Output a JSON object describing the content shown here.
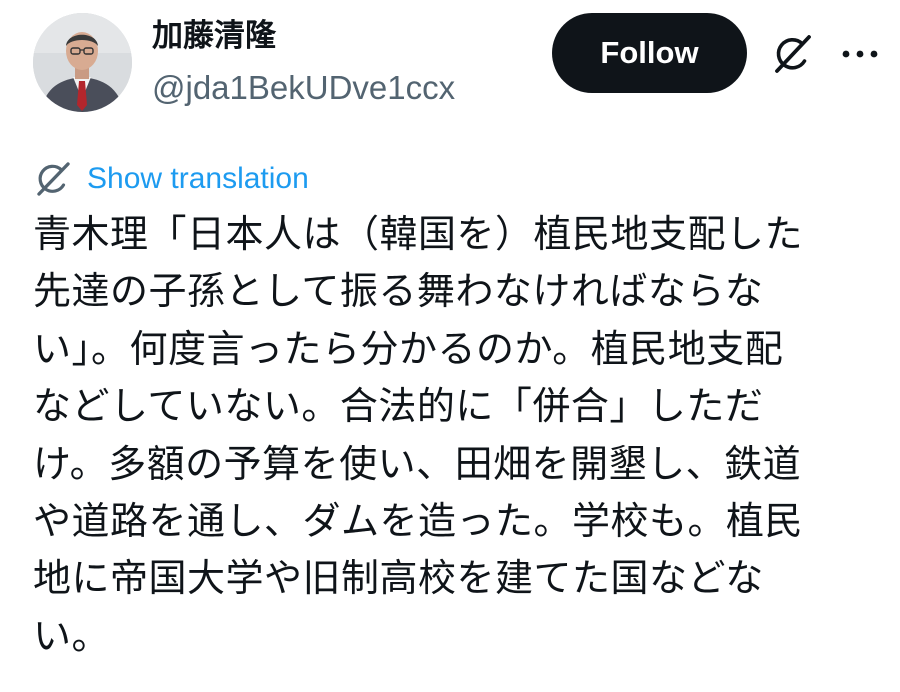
{
  "author": {
    "display_name": "加藤清隆",
    "handle": "@jda1BekUDve1ccx"
  },
  "actions": {
    "follow_label": "Follow"
  },
  "translation": {
    "label": "Show translation"
  },
  "tweet": {
    "lines": [
      "青木理「日本人は（韓国を）植民地支配した",
      "先達の子孫として振る舞わなければならな",
      "い」。何度言ったら分かるのか。植民地支配",
      "などしていない。合法的に「併合」しただ",
      "け。多額の予算を使い、田畑を開墾し、鉄道",
      "や道路を通し、ダムを造った。学校も。植民",
      "地に帝国大学や旧制高校を建てた国などな",
      "い。"
    ]
  },
  "icons": {
    "grok": "grok-icon",
    "more": "more-icon",
    "translate": "translate-icon"
  },
  "colors": {
    "text": "#0f1419",
    "secondary": "#536471",
    "link": "#1d9bf0",
    "follow_bg": "#0f1419"
  }
}
